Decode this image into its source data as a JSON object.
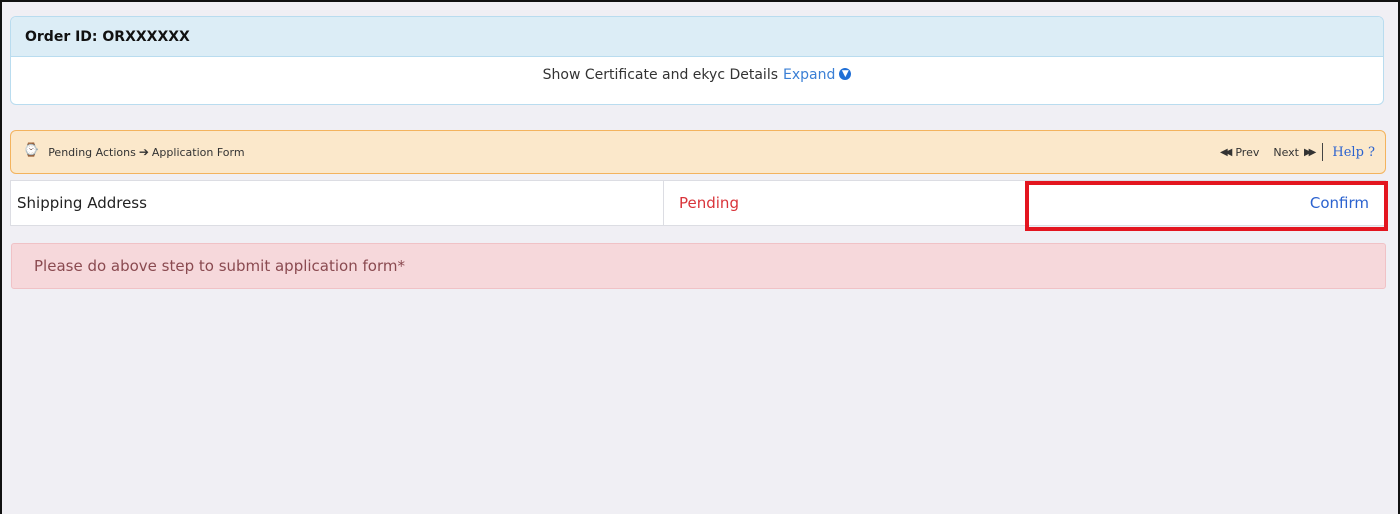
{
  "order": {
    "label": "Order ID: ORXXXXXX",
    "details_text": "Show Certificate and ekyc Details",
    "expand_label": "Expand",
    "expand_icon": "circle-chevron-down-icon"
  },
  "pending_bar": {
    "icon": "clock-icon",
    "breadcrumb": [
      "Pending Actions",
      "Application Form"
    ],
    "prev_label": "Prev",
    "next_label": "Next",
    "help_label": "Help ?"
  },
  "actions": [
    {
      "name": "Shipping Address",
      "status": "Pending",
      "action": "Confirm"
    }
  ],
  "alert": {
    "text": "Please do above step to submit application form*"
  },
  "colors": {
    "pending": "#d9343a",
    "link": "#2b62cf",
    "highlight": "#e3151f",
    "alert_bg": "#f6d8db",
    "bar_bg": "#fbe8cb"
  }
}
